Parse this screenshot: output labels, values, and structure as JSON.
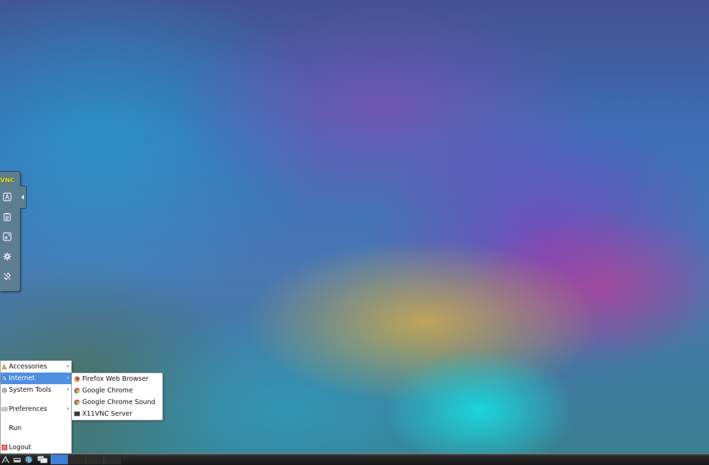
{
  "vnc_panel": {
    "logo_text": "VNC",
    "buttons": [
      "keyboard-icon",
      "clipboard-icon",
      "fullscreen-icon",
      "settings-icon",
      "disconnect-icon"
    ]
  },
  "main_menu": {
    "items": [
      {
        "label": "Accessories",
        "icon": "accessories-icon",
        "has_submenu": true
      },
      {
        "label": "Internet",
        "icon": "internet-icon",
        "has_submenu": true,
        "selected": true
      },
      {
        "label": "System Tools",
        "icon": "system-tools-icon",
        "has_submenu": true
      },
      {
        "label": "Preferences",
        "icon": "preferences-icon",
        "has_submenu": true
      },
      {
        "label": "Run",
        "icon": "",
        "has_submenu": false
      },
      {
        "label": "Logout",
        "icon": "logout-icon",
        "has_submenu": false
      }
    ]
  },
  "internet_submenu": {
    "items": [
      {
        "label": "Firefox Web Browser",
        "icon": "firefox-icon"
      },
      {
        "label": "Google Chrome",
        "icon": "chrome-icon"
      },
      {
        "label": "Google Chrome Sound",
        "icon": "chrome-icon"
      },
      {
        "label": "X11VNC Server",
        "icon": "terminal-icon"
      }
    ]
  },
  "taskbar": {
    "launchers": [
      "start-menu-icon",
      "file-manager-icon",
      "web-browser-icon",
      "show-desktop-icon"
    ],
    "active_color": "#3a7fd8"
  },
  "colors": {
    "menu_selection": "#4f8fe0",
    "vnc_panel": "#5d7e91",
    "vnc_logo": "#e9e625"
  }
}
